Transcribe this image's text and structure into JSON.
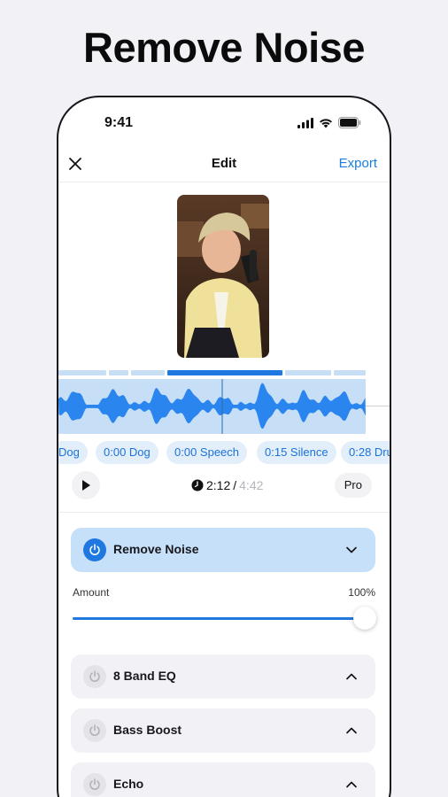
{
  "headline": "Remove Noise",
  "status_bar": {
    "time": "9:41"
  },
  "nav": {
    "title": "Edit",
    "export_label": "Export"
  },
  "chips": [
    "Dog",
    "0:00 Dog",
    "0:00 Speech",
    "0:15 Silence",
    "0:28 Dru"
  ],
  "player": {
    "current_time": "2:12",
    "separator": " /",
    "total_time": "4:42",
    "pro_label": "Pro"
  },
  "effects": [
    {
      "label": "Remove Noise",
      "active": true,
      "expanded": true
    },
    {
      "label": "8 Band EQ",
      "active": false,
      "expanded": false
    },
    {
      "label": "Bass Boost",
      "active": false,
      "expanded": false
    },
    {
      "label": "Echo",
      "active": false,
      "expanded": false
    }
  ],
  "amount": {
    "label": "Amount",
    "value_text": "100%",
    "value": 1.0
  },
  "colors": {
    "accent": "#1f78df",
    "wave": "#2a86ee",
    "wave_bg": "#c6dff7",
    "active_card": "#c7e0fa"
  }
}
